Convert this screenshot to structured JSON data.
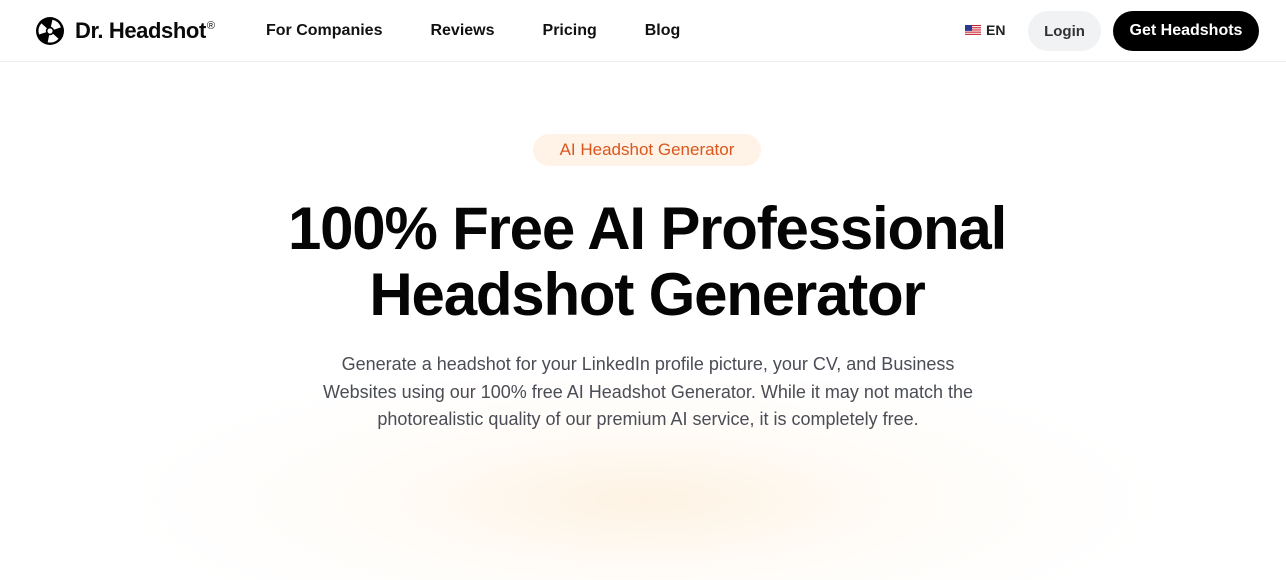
{
  "header": {
    "brand": "Dr. Headshot",
    "brand_mark": "®",
    "logo_icon": "aperture-icon",
    "nav": [
      {
        "label": "For Companies"
      },
      {
        "label": "Reviews"
      },
      {
        "label": "Pricing"
      },
      {
        "label": "Blog"
      }
    ],
    "language": {
      "icon": "us-flag-icon",
      "label": "EN"
    },
    "login_label": "Login",
    "cta_label": "Get Headshots"
  },
  "hero": {
    "badge": "AI Headshot Generator",
    "title_line1": "100% Free AI Professional",
    "title_line2": "Headshot Generator",
    "subtitle": "Generate a headshot for your LinkedIn profile picture, your CV, and Business Websites using our 100% free AI Headshot Generator. While it may not match the photorealistic quality of our premium AI service, it is completely free."
  },
  "colors": {
    "accent": "#d9571c",
    "badge_bg": "#fff3e7",
    "cta_bg": "#000000",
    "login_bg": "#f1f2f4"
  }
}
